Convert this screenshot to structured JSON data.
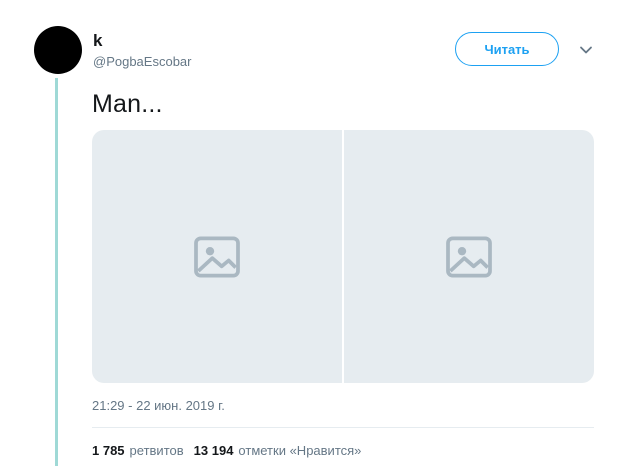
{
  "tweet": {
    "author": {
      "display_name": "k",
      "handle": "@PogbaEscobar"
    },
    "follow_label": "Читать",
    "text": "Man...",
    "media": {
      "photos": [
        {
          "icon": "image-icon"
        },
        {
          "icon": "image-icon"
        }
      ]
    },
    "timestamp": "21:29 - 22 июн. 2019 г.",
    "stats": {
      "retweets_count": "1 785",
      "retweets_label": "ретвитов",
      "likes_count": "13 194",
      "likes_label": "отметки «Нравится»"
    }
  },
  "colors": {
    "accent": "#1da1f2",
    "thread_line": "#9fd9d6",
    "secondary_text": "#657786",
    "primary_text": "#14171a"
  }
}
